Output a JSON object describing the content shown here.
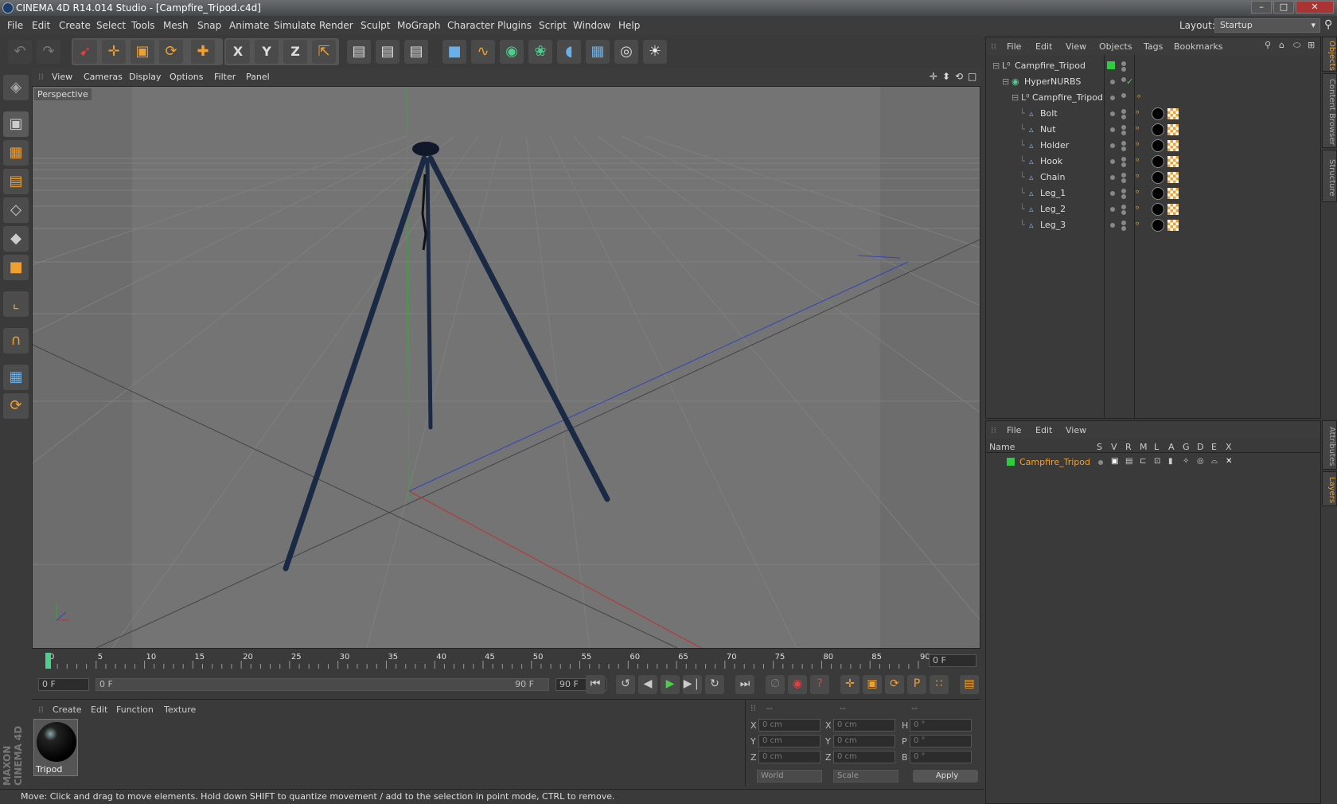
{
  "window": {
    "title": "CINEMA 4D R14.014 Studio - [Campfire_Tripod.c4d]",
    "buttons": [
      "–",
      "□",
      "✕"
    ]
  },
  "menubar": {
    "items": [
      "File",
      "Edit",
      "Create",
      "Select",
      "Tools",
      "Mesh",
      "Snap",
      "Animate",
      "Simulate",
      "Render",
      "Sculpt",
      "MoGraph",
      "Character",
      "Plugins",
      "Script",
      "Window",
      "Help"
    ],
    "layout_label": "Layout:",
    "layout_value": "Startup"
  },
  "toolbar": {
    "icons": [
      "undo-icon",
      "redo-icon",
      "live-select-icon",
      "move-icon",
      "scale-icon",
      "rotate-icon",
      "add-icon",
      "x-axis-icon",
      "y-axis-icon",
      "z-axis-icon",
      "world-coords-icon",
      "render-view-icon",
      "render-picture-viewer-icon",
      "render-settings-icon",
      "cube-icon",
      "spline-icon",
      "nurbs-icon",
      "mograph-icon",
      "deformer-icon",
      "floor-icon",
      "camera-icon",
      "light-icon"
    ],
    "glyphs": {
      "undo": "↶",
      "redo": "↷",
      "select": "➹",
      "move": "✛",
      "scale": "▣",
      "rotate": "⟳",
      "add": "✚",
      "x": "X",
      "y": "Y",
      "z": "Z",
      "world": "⇱",
      "render1": "▤",
      "render2": "▤",
      "render3": "▤",
      "cube": "■",
      "spline": "∿",
      "nurbs": "◉",
      "mograph": "❀",
      "deformer": "◖",
      "floor": "▦",
      "camera": "◎",
      "light": "☀"
    }
  },
  "lefttools": {
    "icons": [
      "make-editable-icon",
      "model-mode-icon",
      "texture-mode-icon",
      "workplane-icon",
      "points-mode-icon",
      "edges-mode-icon",
      "polygons-mode-icon",
      "axis-mode-icon",
      "snap-magnet-icon",
      "grid-lock-icon",
      "soft-selection-icon"
    ],
    "glyphs": [
      "◈",
      "▣",
      "▦",
      "▤",
      "◇",
      "◆",
      "■",
      "⌞",
      "∩",
      "▦",
      "⟳"
    ]
  },
  "viewport": {
    "menu": [
      "View",
      "Cameras",
      "Display",
      "Options",
      "Filter",
      "Panel"
    ],
    "label": "Perspective",
    "nav_icons": [
      "✛",
      "⬍",
      "⟲",
      "□"
    ]
  },
  "timeline": {
    "ticks": [
      "0",
      "5",
      "10",
      "15",
      "20",
      "25",
      "30",
      "35",
      "40",
      "45",
      "50",
      "55",
      "60",
      "65",
      "70",
      "75",
      "80",
      "85",
      "90"
    ],
    "current_frame": "0 F"
  },
  "transport": {
    "start": "0 F",
    "range_start": "0 F",
    "range_end": "90 F",
    "end": "90 F",
    "buttons": [
      "⏮",
      "↺",
      "◀",
      "▶",
      "▶❘",
      "↻",
      "⏭"
    ],
    "key_buttons": [
      "∅",
      "◉",
      "?"
    ],
    "track_buttons": [
      "✛",
      "▣",
      "⟳",
      "P",
      "∷"
    ],
    "timeline_button": "▤"
  },
  "material_manager": {
    "menu": [
      "Create",
      "Edit",
      "Function",
      "Texture"
    ],
    "materials": [
      {
        "name": "Tripod"
      }
    ]
  },
  "coordinates": {
    "headers": [
      "--",
      "--",
      "--"
    ],
    "rows": [
      {
        "a": "X",
        "av": "0 cm",
        "b": "X",
        "bv": "0 cm",
        "c": "H",
        "cv": "0 °"
      },
      {
        "a": "Y",
        "av": "0 cm",
        "b": "Y",
        "bv": "0 cm",
        "c": "P",
        "cv": "0 °"
      },
      {
        "a": "Z",
        "av": "0 cm",
        "b": "Z",
        "bv": "0 cm",
        "c": "B",
        "cv": "0 °"
      }
    ],
    "mode1": "World",
    "mode2": "Scale",
    "apply": "Apply"
  },
  "statusbar": {
    "text": "Move: Click and drag to move elements. Hold down SHIFT to quantize movement / add to the selection in point mode, CTRL to remove."
  },
  "object_manager": {
    "menu": [
      "File",
      "Edit",
      "View",
      "Objects",
      "Tags",
      "Bookmarks"
    ],
    "objects": [
      {
        "name": "Campfire_Tripod",
        "level": 0
      },
      {
        "name": "HyperNURBS",
        "level": 1
      },
      {
        "name": "Campfire_Tripod",
        "level": 2
      },
      {
        "name": "Bolt",
        "level": 3
      },
      {
        "name": "Nut",
        "level": 3
      },
      {
        "name": "Holder",
        "level": 3
      },
      {
        "name": "Hook",
        "level": 3
      },
      {
        "name": "Chain",
        "level": 3
      },
      {
        "name": "Leg_1",
        "level": 3
      },
      {
        "name": "Leg_2",
        "level": 3
      },
      {
        "name": "Leg_3",
        "level": 3
      }
    ]
  },
  "layer_manager": {
    "menu": [
      "File",
      "Edit",
      "View"
    ],
    "columns": [
      "Name",
      "S",
      "V",
      "R",
      "M",
      "L",
      "A",
      "G",
      "D",
      "E",
      "X"
    ],
    "layers": [
      {
        "name": "Campfire_Tripod",
        "color": "#2ecc40"
      }
    ]
  },
  "side_tabs": [
    "Objects",
    "Content Browser",
    "Structure",
    "Attributes",
    "Layers"
  ],
  "brand": "MAXON CINEMA 4D",
  "colors": {
    "accent": "#f0a030",
    "layer_green": "#2ecc40",
    "tripod": "#1b2a44"
  }
}
